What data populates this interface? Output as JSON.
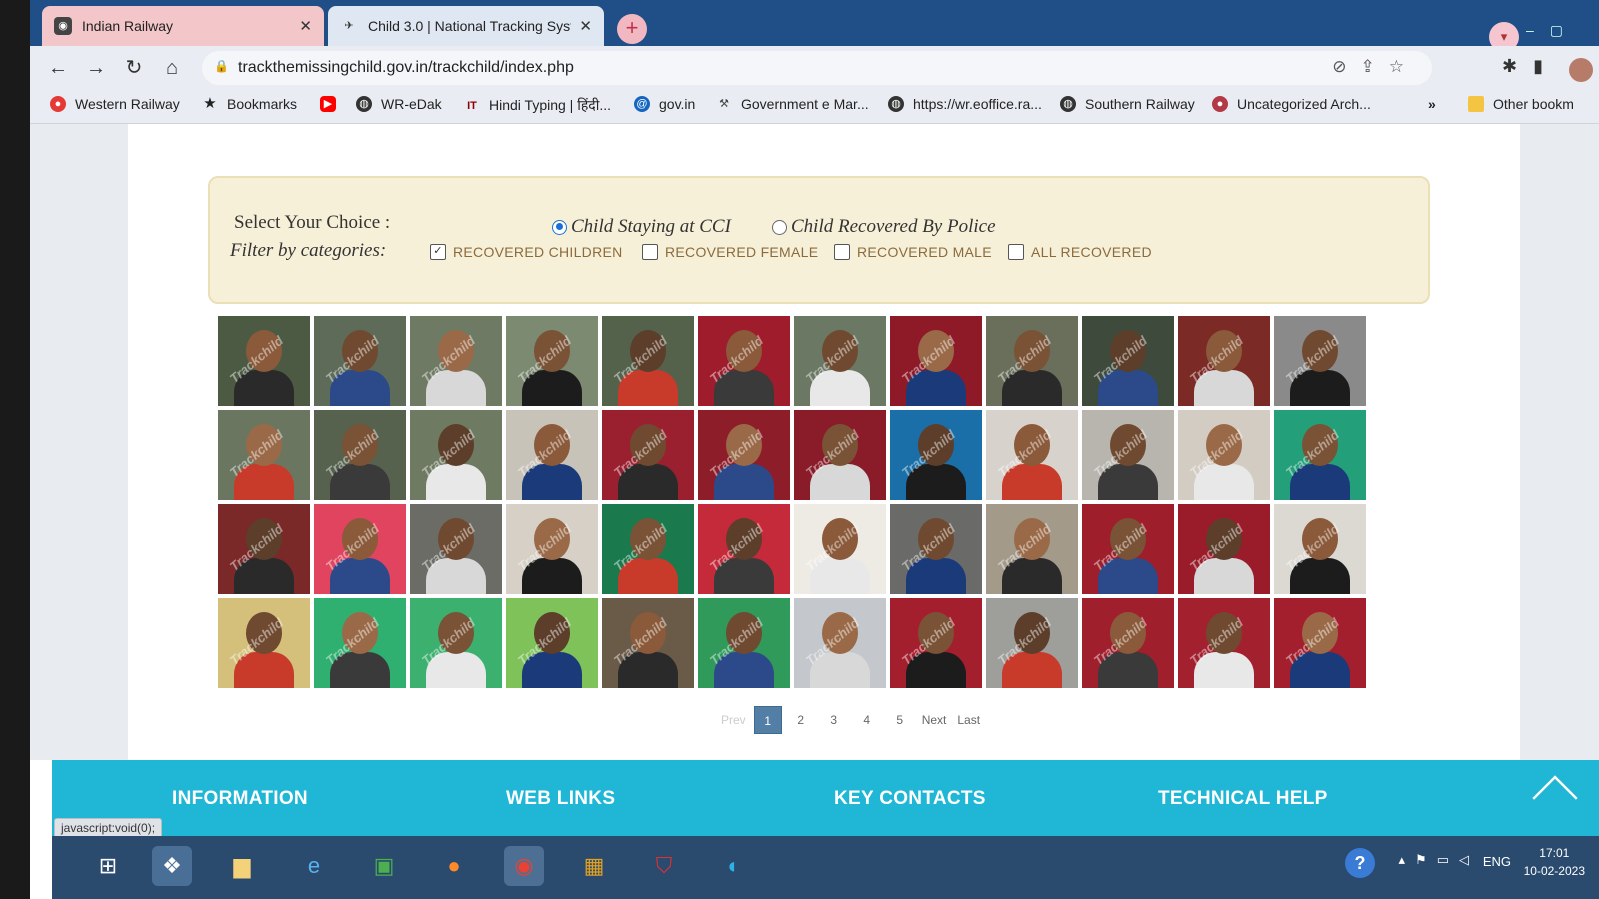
{
  "tabs": [
    {
      "label": "Indian Railway",
      "icon": "railway-icon"
    },
    {
      "label": "Child 3.0 | National Tracking Syst",
      "icon": "trackchild-icon"
    }
  ],
  "address_bar": {
    "url": "trackthemissingchild.gov.in/trackchild/index.php"
  },
  "bookmarks": [
    {
      "label": "Western Railway",
      "color": "#e53935"
    },
    {
      "label": "Bookmarks",
      "color": "#222222"
    },
    {
      "label": "",
      "color": "#ff0000"
    },
    {
      "label": "WR-eDak",
      "color": "#333333"
    },
    {
      "label": "Hindi Typing | हिंदी...",
      "color": "#8b0000"
    },
    {
      "label": "gov.in",
      "color": "#1565c0"
    },
    {
      "label": "Government e Mar...",
      "color": "#444444"
    },
    {
      "label": "https://wr.eoffice.ra...",
      "color": "#333333"
    },
    {
      "label": "Southern Railway",
      "color": "#333333"
    },
    {
      "label": "Uncategorized Arch...",
      "color": "#b23a48"
    },
    {
      "label": "Other bookm",
      "color": "#f4c542"
    }
  ],
  "filter": {
    "choice_label": "Select Your Choice :",
    "filter_label": "Filter by categories:",
    "radios": [
      {
        "label": "Child Staying at CCI",
        "checked": true
      },
      {
        "label": "Child Recovered By Police",
        "checked": false
      }
    ],
    "checkboxes": [
      {
        "label": "RECOVERED CHILDREN",
        "checked": true
      },
      {
        "label": "RECOVERED FEMALE",
        "checked": false
      },
      {
        "label": "RECOVERED MALE",
        "checked": false
      },
      {
        "label": "ALL RECOVERED",
        "checked": false
      }
    ]
  },
  "gallery": {
    "watermark": "Trackchild",
    "rows": 4,
    "cols": 12,
    "backgrounds": [
      "#4c5a43",
      "#5d6b58",
      "#6f7a64",
      "#7d8a72",
      "#54624c",
      "#9e1c2c",
      "#6b7863",
      "#8e1a28",
      "#6a6f5c",
      "#3e4a3c",
      "#7c2a26",
      "#8a8a8a",
      "#6a765f",
      "#56624e",
      "#6f7a62",
      "#c8c3b8",
      "#9a2030",
      "#8e1d2a",
      "#8a1c2a",
      "#1b6fa8",
      "#d8d2cc",
      "#b8b4ae",
      "#d2ccc2",
      "#23a07a",
      "#7a2828",
      "#e0445e",
      "#6c6c66",
      "#d6d0c6",
      "#1a7a4e",
      "#c52a3a",
      "#eeeae4",
      "#6a6a68",
      "#a49a8a",
      "#9e1e2c",
      "#9a1c2a",
      "#dcd8d2",
      "#d4c07a",
      "#2fb070",
      "#3cb06e",
      "#7fc25a",
      "#6a5a48",
      "#2f9a5a",
      "#c4c8cc",
      "#a41f2e",
      "#9e9e9a",
      "#a01f2d",
      "#a3202e",
      "#a41f2e"
    ],
    "faces": [
      "#8a5a3a",
      "#6f4a30",
      "#9a6a48",
      "#7a5236",
      "#5c3e2a"
    ],
    "bodies": [
      "#2a2a2a",
      "#2c4a8a",
      "#d8d8d8",
      "#1c1c1c",
      "#c83a2a",
      "#3a3a3a",
      "#e8e8e8",
      "#1a3a7a"
    ]
  },
  "pagination": {
    "prev": "Prev",
    "pages": [
      "1",
      "2",
      "3",
      "4",
      "5"
    ],
    "current": "1",
    "next": "Next",
    "last": "Last"
  },
  "footer": {
    "links": [
      "INFORMATION",
      "WEB LINKS",
      "KEY CONTACTS",
      "TECHNICAL HELP"
    ],
    "status_text": "javascript:void(0);"
  },
  "taskbar": {
    "lang": "ENG",
    "time": "17:01",
    "date": "10-02-2023"
  }
}
